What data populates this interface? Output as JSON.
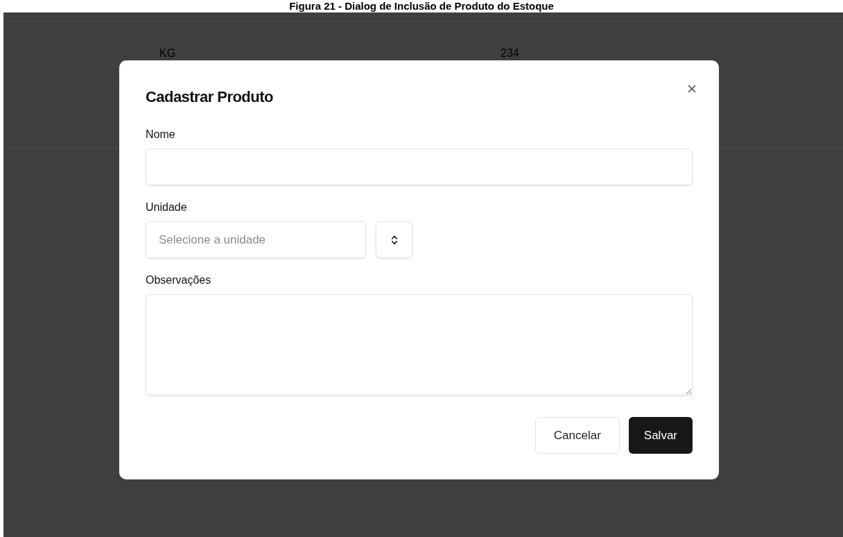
{
  "caption": "Figura 21 - Dialog de Inclusão de Produto do Estoque",
  "background_table": {
    "rows": [
      {
        "cells": [
          "KG",
          "234"
        ]
      }
    ]
  },
  "dialog": {
    "title": "Cadastrar Produto",
    "fields": [
      {
        "kind": "text",
        "label": "Nome"
      },
      {
        "kind": "select",
        "label": "Unidade",
        "placeholder": "Selecione a unidade"
      },
      {
        "kind": "textarea",
        "label": "Observações"
      }
    ],
    "buttons": [
      {
        "label": "Cancelar",
        "kind": "secondary"
      },
      {
        "label": "Salvar",
        "kind": "primary"
      }
    ]
  }
}
